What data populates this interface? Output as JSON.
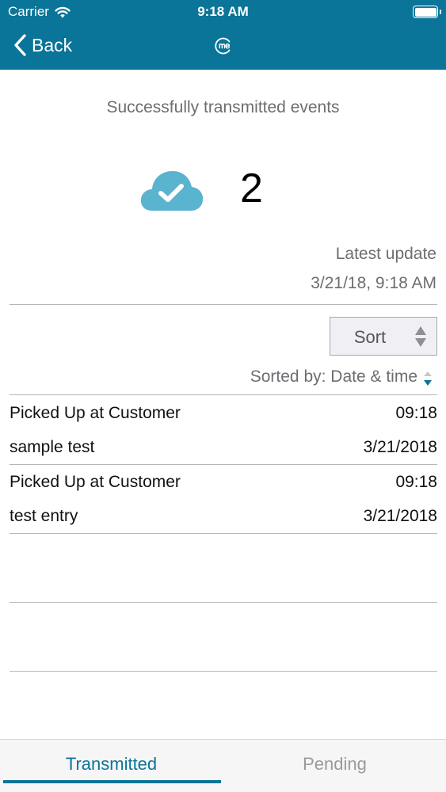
{
  "status_bar": {
    "carrier": "Carrier",
    "time": "9:18 AM",
    "wifi_icon": "wifi-icon",
    "battery_icon": "battery-icon"
  },
  "nav": {
    "back_label": "Back",
    "back_icon": "chevron-left-icon",
    "logo_icon": "me-logo-icon"
  },
  "summary": {
    "headline": "Successfully transmitted events",
    "icon": "cloud-check-icon",
    "count": "2",
    "latest_label": "Latest update",
    "latest_value": "3/21/18, 9:18 AM"
  },
  "sort": {
    "button_label": "Sort",
    "sorted_by": "Sorted by: Date & time",
    "sort_icon": "sort-arrows-icon",
    "direction_icon": "sort-descending-icon"
  },
  "events": [
    {
      "title": "Picked Up at Customer",
      "time": "09:18",
      "note": "sample test",
      "date": "3/21/2018"
    },
    {
      "title": "Picked Up at Customer",
      "time": "09:18",
      "note": "test entry",
      "date": "3/21/2018"
    }
  ],
  "tabs": [
    {
      "label": "Transmitted",
      "active": true
    },
    {
      "label": "Pending",
      "active": false
    }
  ],
  "colors": {
    "brand": "#0a7499",
    "cloud": "#5ab3cf",
    "muted_text": "#6d6d72"
  }
}
